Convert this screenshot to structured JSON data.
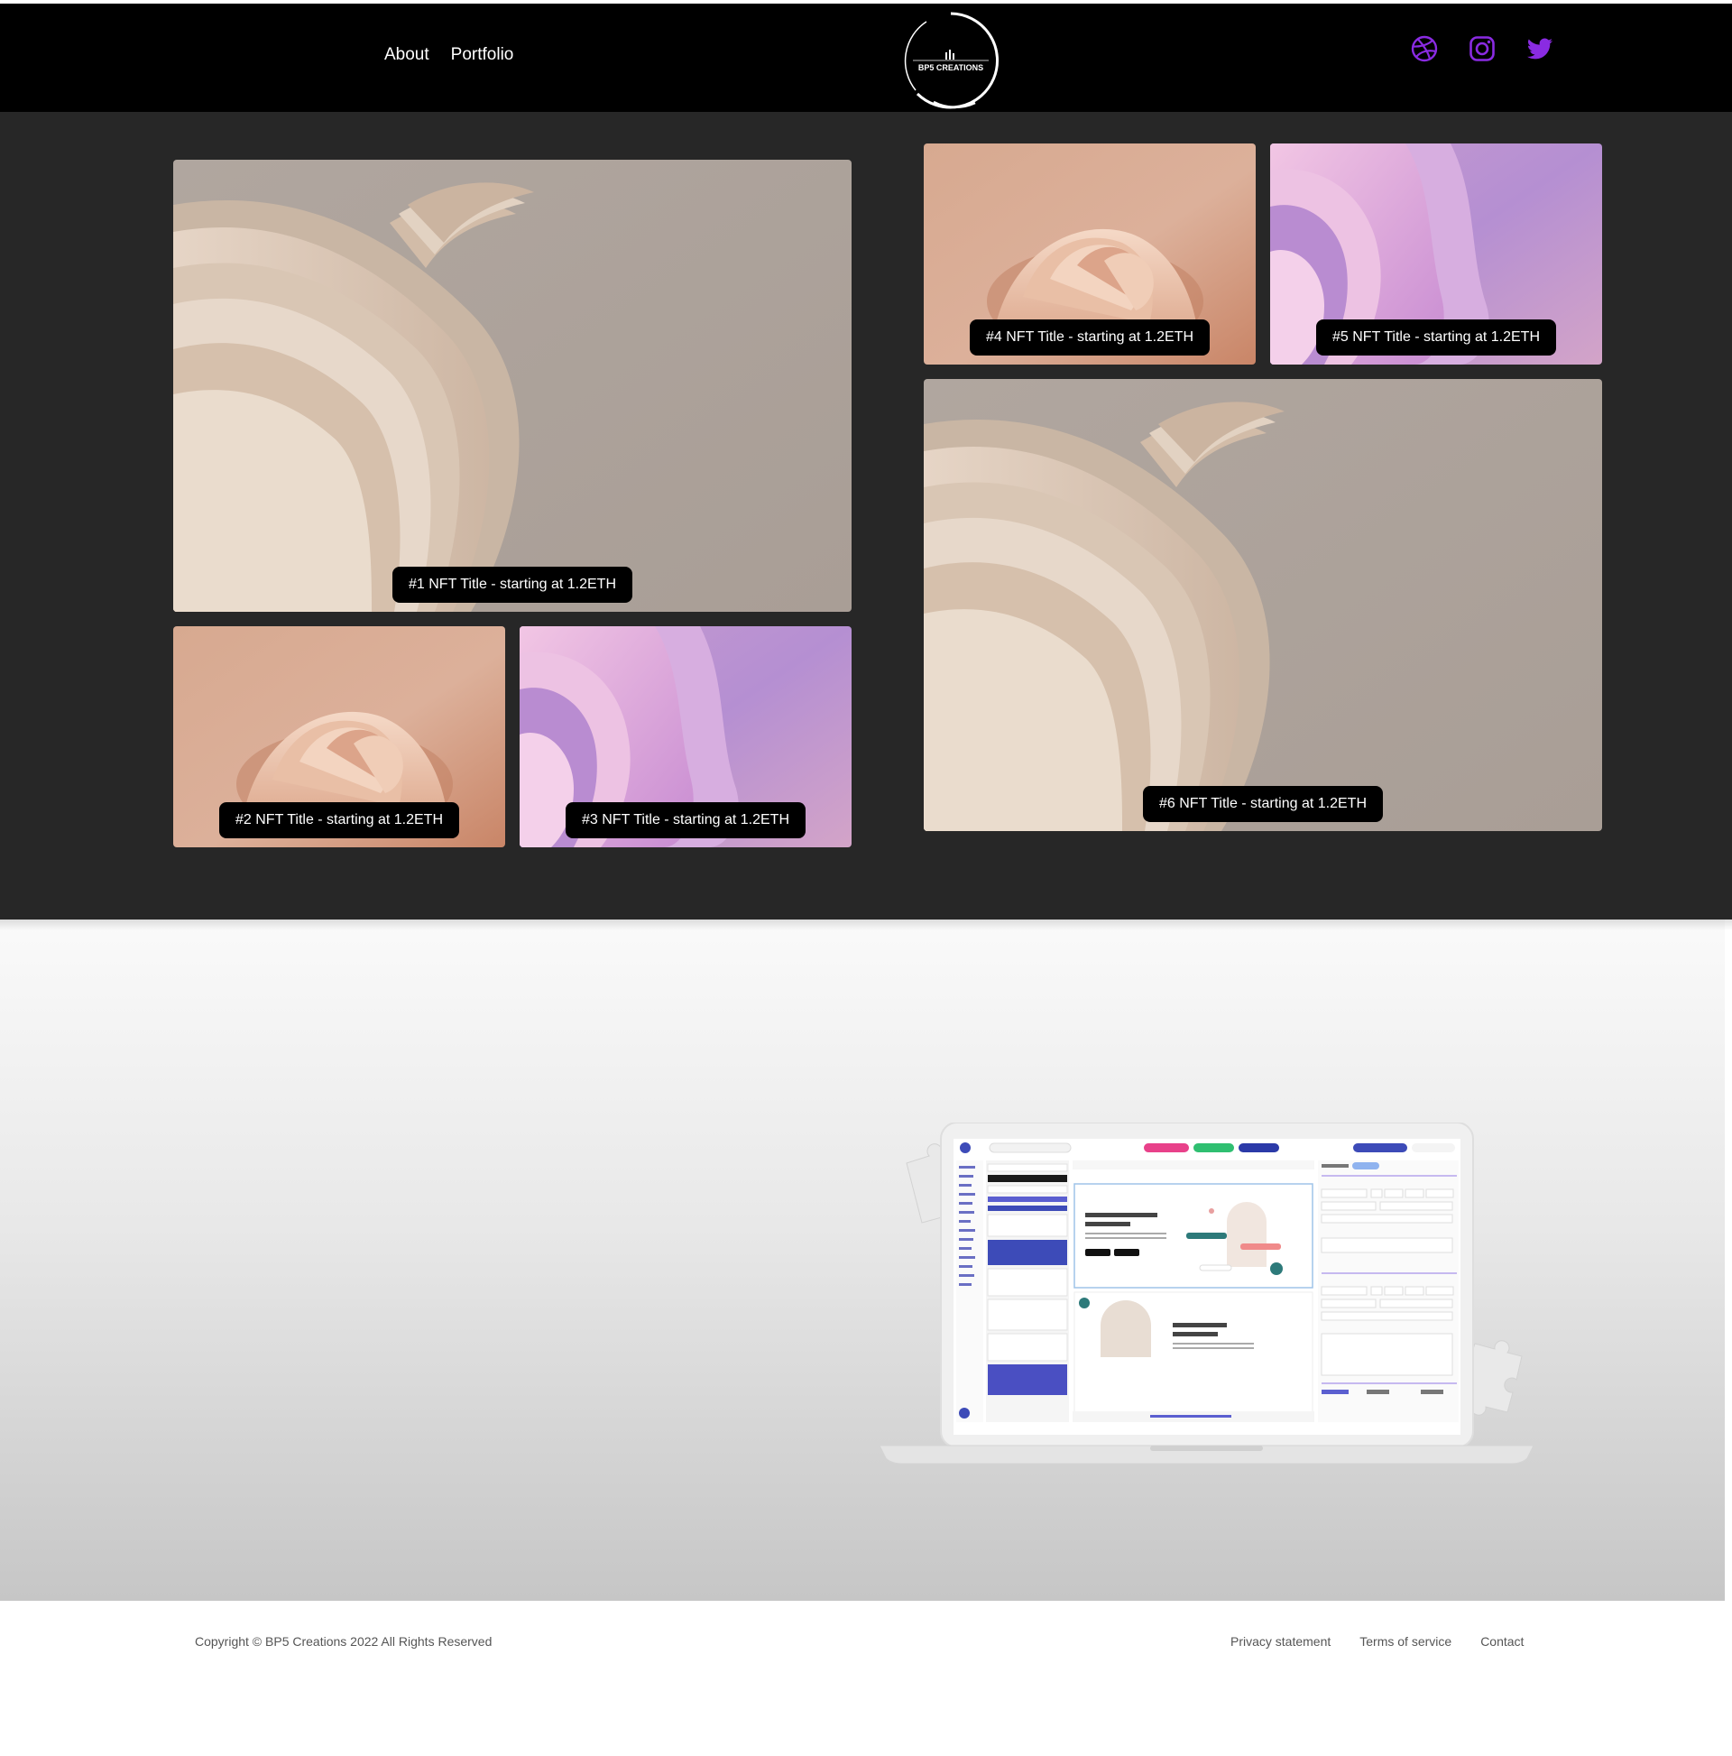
{
  "nav": {
    "about_label": "About",
    "portfolio_label": "Portfolio"
  },
  "brand": {
    "logo_text": "BP5 CREATIONS"
  },
  "social": {
    "accent_color": "#8a2be2",
    "icons": [
      "dribbble-icon",
      "instagram-icon",
      "twitter-icon"
    ]
  },
  "gallery": {
    "tiles": [
      {
        "label": "#1 NFT Title - starting at 1.2ETH",
        "art": "beige-folds"
      },
      {
        "label": "#2 NFT Title - starting at 1.2ETH",
        "art": "peach-folds"
      },
      {
        "label": "#3 NFT Title - starting at 1.2ETH",
        "art": "pink-purple-waves"
      },
      {
        "label": "#4 NFT Title - starting at 1.2ETH",
        "art": "peach-folds"
      },
      {
        "label": "#5 NFT Title - starting at 1.2ETH",
        "art": "pink-purple-waves"
      },
      {
        "label": "#6 NFT Title - starting at 1.2ETH",
        "art": "beige-folds"
      }
    ]
  },
  "colors": {
    "header_bg": "#000000",
    "gallery_bg": "#272727",
    "label_bg": "#000000"
  },
  "footer": {
    "copyright": "Copyright © BP5 Creations 2022 All Rights Reserved",
    "privacy_label": "Privacy statement",
    "terms_label": "Terms of service",
    "contact_label": "Contact"
  }
}
